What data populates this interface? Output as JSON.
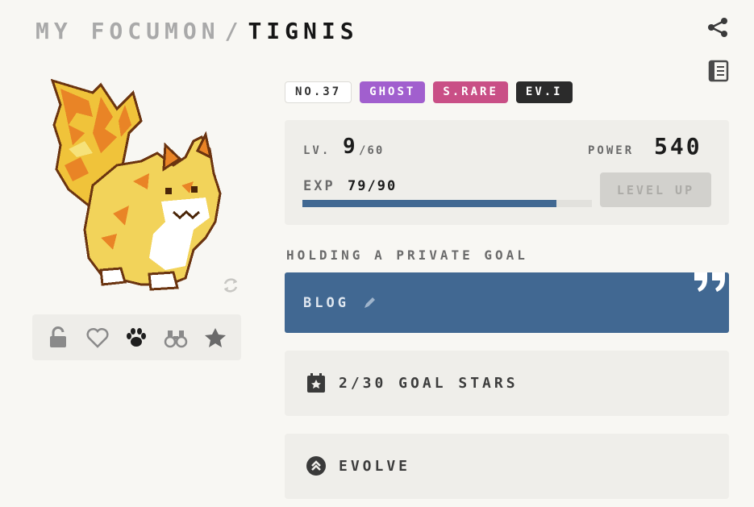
{
  "header": {
    "crumb": "MY FOCUMON",
    "separator": "/",
    "name": "TIGNIS"
  },
  "icons": {
    "share": "share-icon",
    "journal": "journal-icon",
    "refresh": "refresh-icon",
    "pencil": "pencil-icon",
    "calendar_star": "calendar-star-icon",
    "evolve": "chevrons-up-icon"
  },
  "creature": {
    "species": "TIGNIS",
    "image": "pixel-fire-fox-creature"
  },
  "actions": [
    {
      "name": "unlock",
      "icon": "unlock-icon"
    },
    {
      "name": "favorite",
      "icon": "heart-icon"
    },
    {
      "name": "paw",
      "icon": "paw-icon"
    },
    {
      "name": "explore",
      "icon": "binoculars-icon"
    },
    {
      "name": "badge",
      "icon": "star-badge-icon"
    }
  ],
  "tags": {
    "number": "NO.37",
    "type": "GHOST",
    "rarity": "S.RARE",
    "evolution": "EV.I"
  },
  "stats": {
    "level_label": "LV.",
    "level": "9",
    "level_max": "/60",
    "power_label": "POWER",
    "power": "540",
    "exp_label": "EXP",
    "exp": "79/90",
    "exp_fraction": 0.878,
    "level_up_label": "LEVEL UP"
  },
  "goal": {
    "holding_label": "HOLDING A PRIVATE GOAL",
    "title": "BLOG"
  },
  "goal_stars": {
    "label": "2/30 GOAL STARS"
  },
  "evolve": {
    "label": "EVOLVE"
  },
  "colors": {
    "background": "#f8f7f3",
    "card": "#efeeea",
    "goal_blue": "#416892",
    "ghost_purple": "#a15fce",
    "rare_pink": "#c94f86",
    "ev_dark": "#2b2b2b"
  }
}
